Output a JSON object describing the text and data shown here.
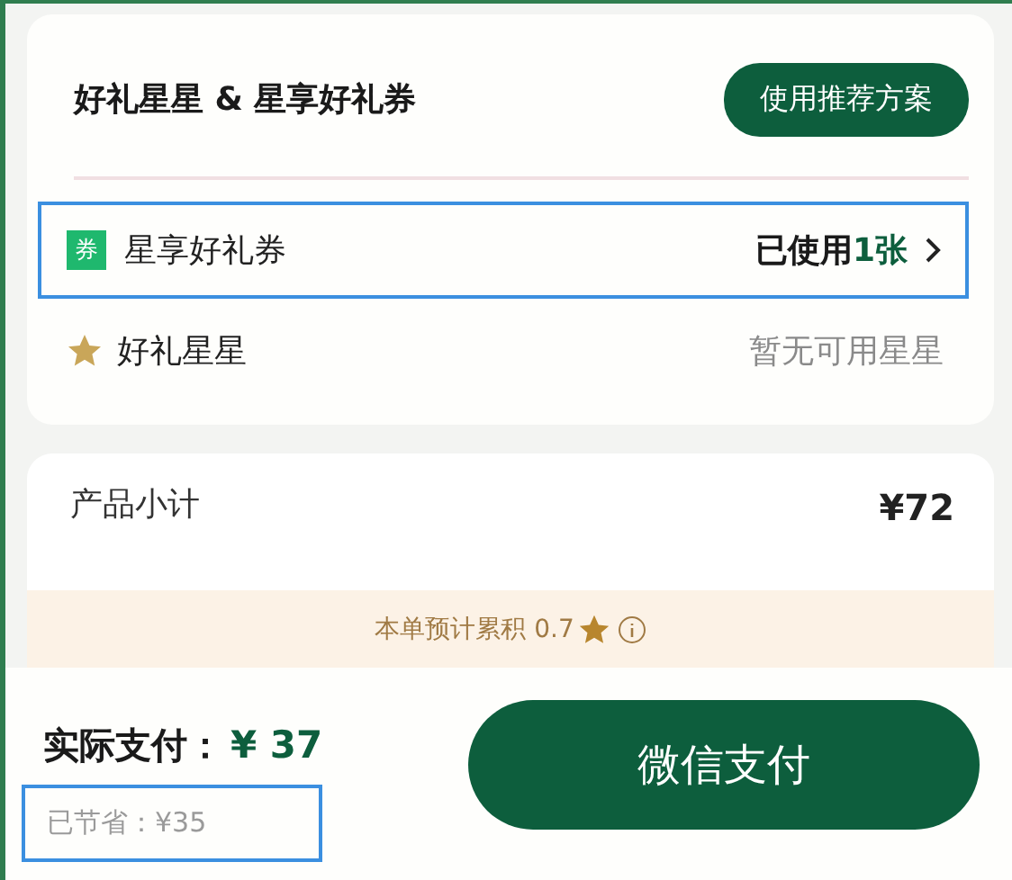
{
  "rewards_card": {
    "title": "好礼星星 & 星享好礼券",
    "recommend_button": "使用推荐方案",
    "rows": [
      {
        "kind": "coupon",
        "badge": "券",
        "label": "星享好礼券",
        "value": "已使用",
        "value_highlight": "1张",
        "highlighted": true
      },
      {
        "kind": "stars",
        "label": "好礼星星",
        "value": "暂无可用星星",
        "highlighted": false
      }
    ]
  },
  "subtotal": {
    "label": "产品小计",
    "amount": "¥72"
  },
  "banner": {
    "text": "本单预计累积 0.7"
  },
  "footer": {
    "pay_label": "实际支付：",
    "pay_amount": "¥ 37",
    "saved": "已节省：¥35",
    "saved_highlighted": true,
    "pay_button": "微信支付"
  }
}
